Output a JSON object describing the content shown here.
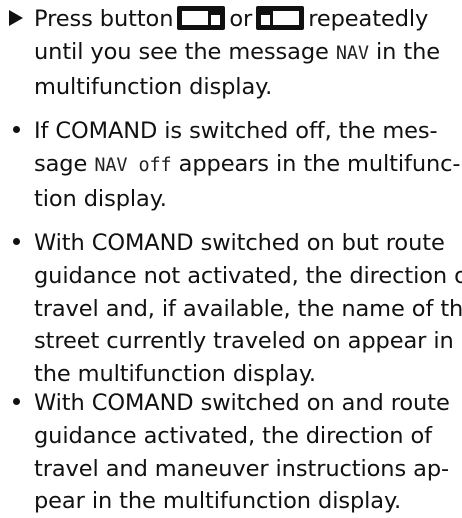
{
  "instruction": {
    "marker": "triangle-bullet-icon",
    "text_before": "Press button",
    "button_1_icon": "display-back-button-icon",
    "text_middle": "or",
    "button_2_icon": "display-forward-button-icon",
    "text_after": "repeatedly",
    "line2_a": "until you see the message",
    "line2_code": "NAV",
    "line2_b": "in the",
    "line3": "multifunction display."
  },
  "bullets": [
    {
      "line1": "If COMAND is switched off, the mes-",
      "line2_a": "sage",
      "line2_code": "NAV off",
      "line2_b": "appears in the multifunc-",
      "line3": "tion display."
    },
    {
      "lines": [
        "With COMAND switched on but route",
        "guidance not activated, the direction of",
        "travel and, if available, the name of the",
        "street currently traveled on appear in",
        "the multifunction display."
      ]
    },
    {
      "lines": [
        "With COMAND switched on and route",
        "guidance activated, the direction of",
        "travel and maneuver instructions ap-",
        "pear in the multifunction display."
      ]
    }
  ]
}
